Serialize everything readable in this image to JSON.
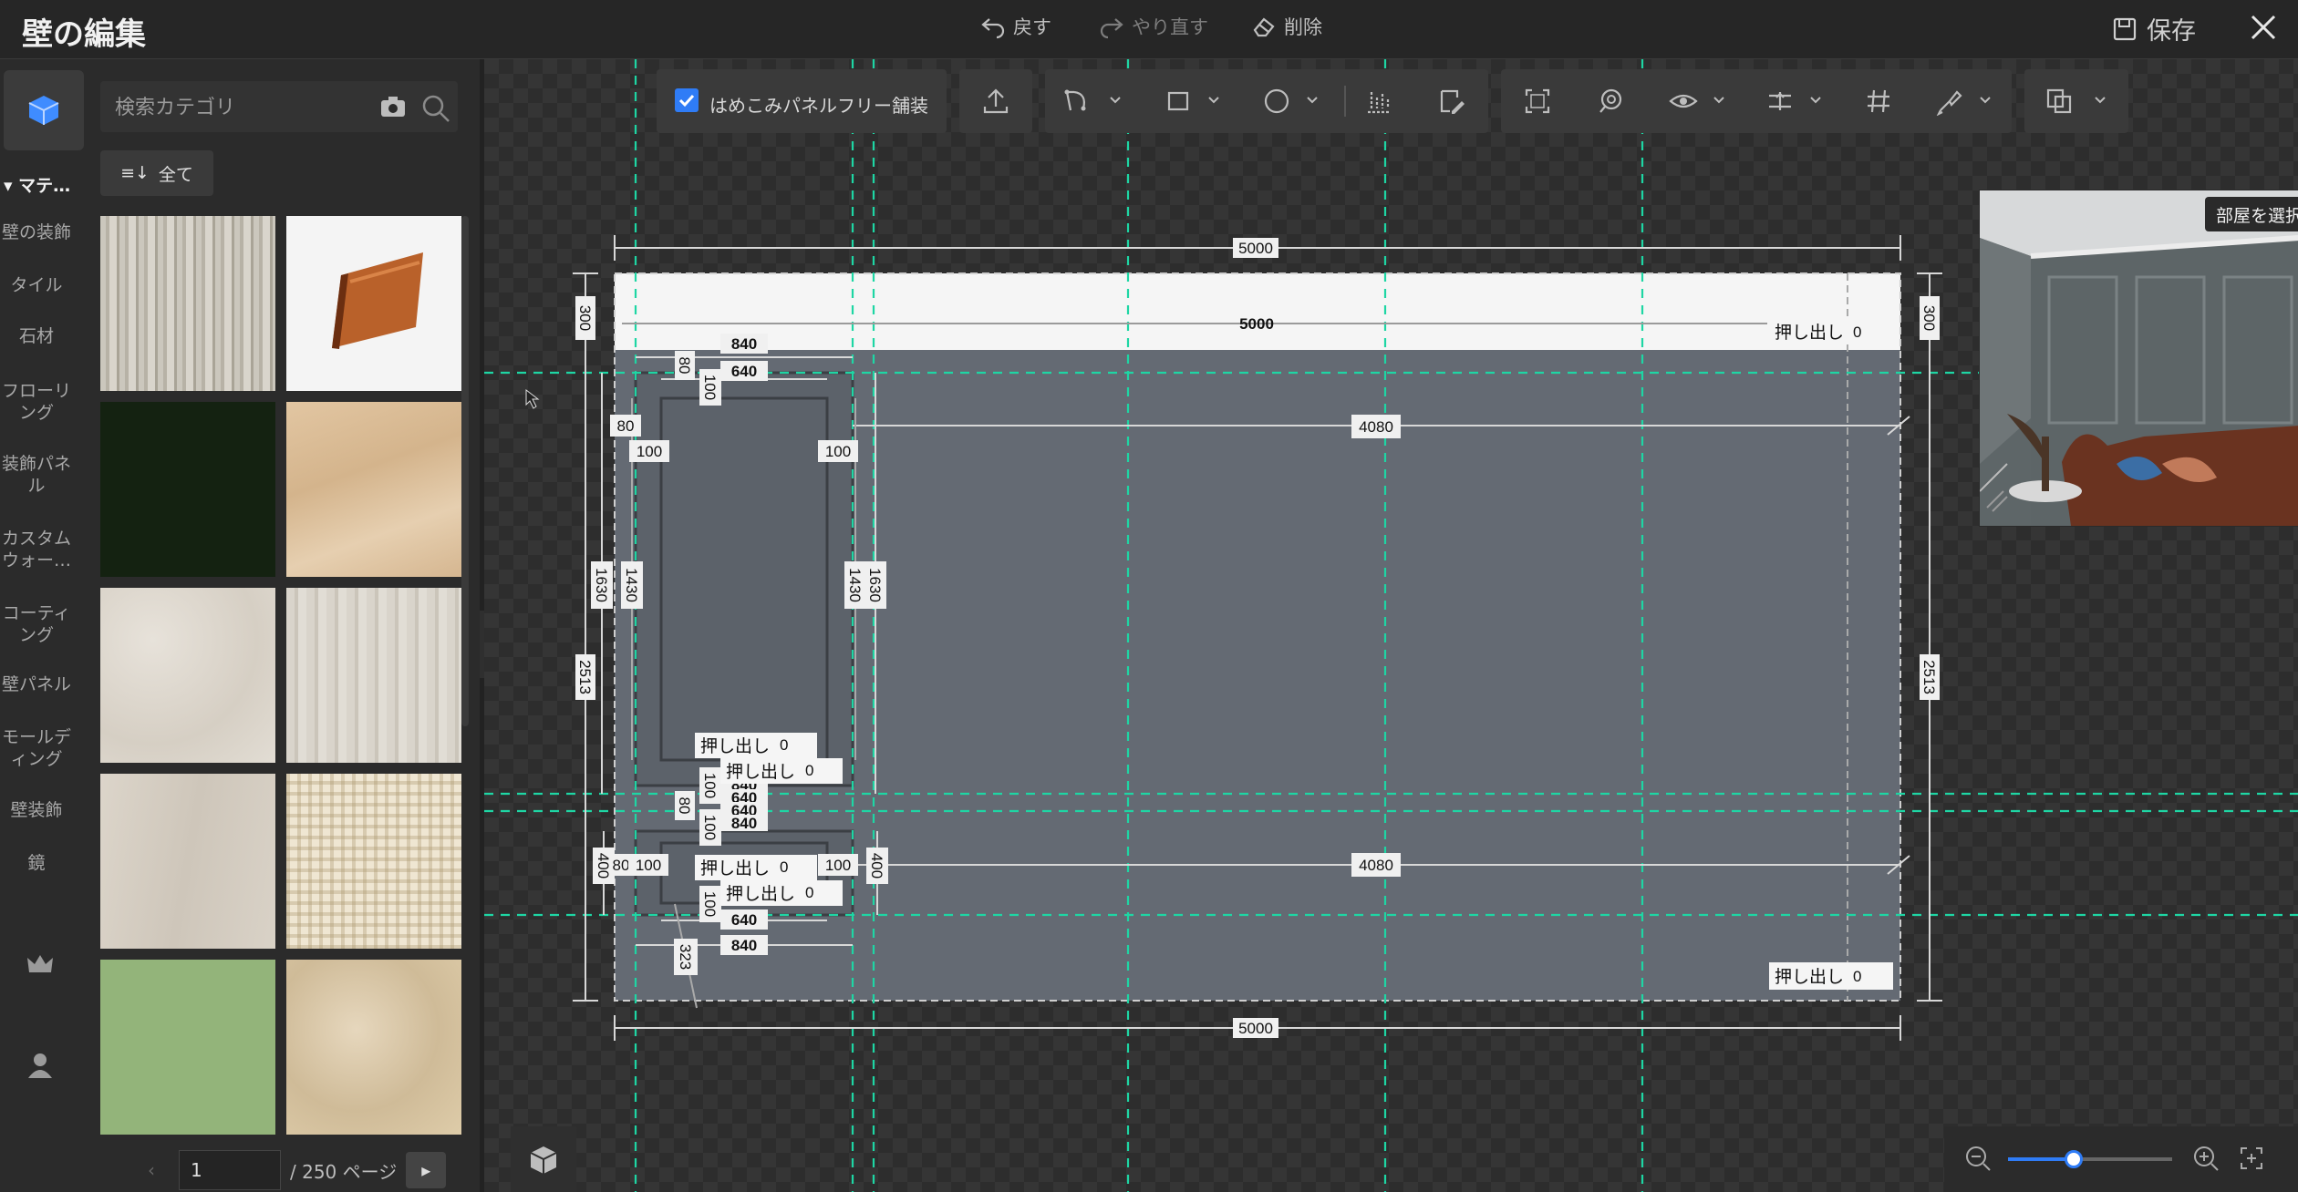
{
  "header": {
    "title": "壁の編集",
    "undo_label": "戻す",
    "redo_label": "やり直す",
    "delete_label": "削除",
    "save_label": "保存"
  },
  "rail": {
    "section_label": "マテ…",
    "items": [
      "壁の装飾",
      "タイル",
      "石材",
      "フローリング",
      "装飾パネル",
      "カスタムウォー…",
      "コーティング",
      "壁パネル",
      "モールディング",
      "壁装飾",
      "鏡"
    ]
  },
  "panel": {
    "search_placeholder": "検索カテゴリ",
    "all_label": "全て",
    "thumbnails": [
      "wood-grain-gray",
      "baseboard-molding",
      "dark-green",
      "light-oak",
      "white-marble-tile",
      "white-washed-wood",
      "pale-wood",
      "woven-pattern",
      "sage-green",
      "beige-marble"
    ],
    "page_value": "1",
    "page_total": "/ 250 ページ"
  },
  "toolbar": {
    "checkbox_label": "はめこみパネルフリー舗装",
    "checked": true
  },
  "preview": {
    "room_select_label": "部屋を選択"
  },
  "drawing": {
    "dim_top": "5000",
    "dim_top_inner": "5000",
    "dim_bottom": "5000",
    "dim_left_top": "300",
    "dim_right_top": "300",
    "dim_left_total": "2513",
    "dim_right_total": "2513",
    "extrude_label": "押し出し",
    "extrude_value": "0",
    "panel1": {
      "width_outer": "840",
      "width_inner": "640",
      "height_outer": "1630",
      "height_inner": "1430",
      "gap_80": "80",
      "gap_100": "100",
      "offset_right": "4080"
    },
    "panel2": {
      "width_outer": "840",
      "width_inner": "640",
      "height": "400",
      "gap_80": "80",
      "gap_100": "100",
      "offset_right": "4080",
      "bottom_gap": "323"
    }
  },
  "zoom": {
    "level": 0.4
  },
  "colors": {
    "accent": "#2f7cf6",
    "guide": "#1ed6a4",
    "wall_gray": "#646a73",
    "wall_white": "#f5f5f5"
  }
}
